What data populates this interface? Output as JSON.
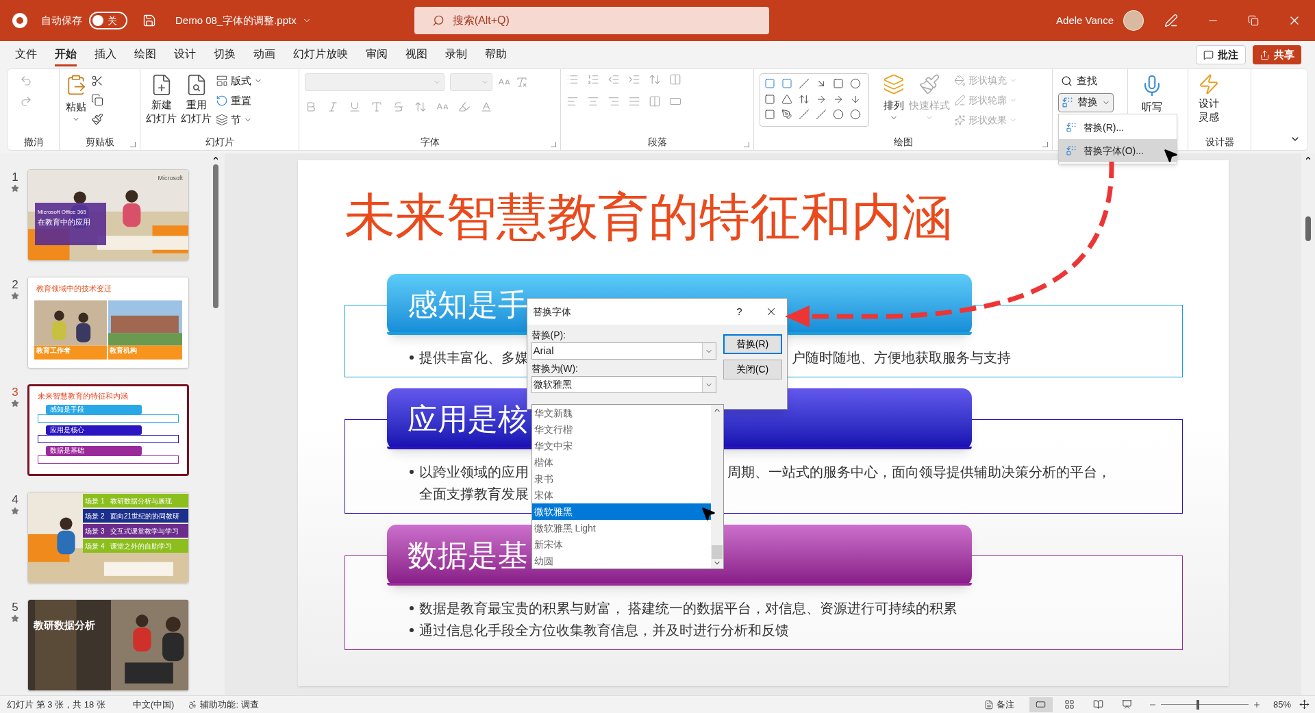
{
  "title_bar": {
    "autosave_label": "自动保存",
    "autosave_toggle": {
      "on": false,
      "label": "关"
    },
    "file_name": "Demo 08_字体的调整.pptx",
    "search_placeholder": "搜索(Alt+Q)",
    "user_name": "Adele Vance"
  },
  "menu_tabs": [
    {
      "label": "文件",
      "selected": false
    },
    {
      "label": "开始",
      "selected": true
    },
    {
      "label": "插入",
      "selected": false
    },
    {
      "label": "绘图",
      "selected": false
    },
    {
      "label": "设计",
      "selected": false
    },
    {
      "label": "切换",
      "selected": false
    },
    {
      "label": "动画",
      "selected": false
    },
    {
      "label": "幻灯片放映",
      "selected": false
    },
    {
      "label": "审阅",
      "selected": false
    },
    {
      "label": "视图",
      "selected": false
    },
    {
      "label": "录制",
      "selected": false
    },
    {
      "label": "帮助",
      "selected": false
    }
  ],
  "comments_button": "批注",
  "share_button": "共享",
  "ribbon": {
    "undo_label": "撤消",
    "clipboard": {
      "paste": "粘贴",
      "label": "剪贴板"
    },
    "slides": {
      "new_slide": [
        "新建",
        "幻灯片"
      ],
      "reuse_slide": [
        "重用",
        "幻灯片"
      ],
      "layout": "版式",
      "reset": "重置",
      "section": "节",
      "label": "幻灯片"
    },
    "font_label": "字体",
    "paragraph_label": "段落",
    "drawing": {
      "arrange": "排列",
      "quick_styles": "快速样式",
      "shape_fill": "形状填充",
      "shape_outline": "形状轮廓",
      "shape_effects": "形状效果",
      "label": "绘图"
    },
    "editing": {
      "find": "查找",
      "replace": "替换"
    },
    "dictate": "听写",
    "designer": {
      "button": [
        "设计",
        "灵感"
      ],
      "label": "设计器"
    }
  },
  "replace_menu": [
    {
      "label": "替换(R)...",
      "selected": false
    },
    {
      "label": "替换字体(O)...",
      "selected": true
    }
  ],
  "thumbnails": [
    {
      "number": "1",
      "selected": false,
      "kind": "cover",
      "brand": "Microsoft",
      "subtitle": "Microsoft Office 365",
      "title": "在教育中的应用"
    },
    {
      "number": "2",
      "selected": false,
      "kind": "two_photos",
      "title": "教育领域中的技术变迁",
      "captions": [
        "教育工作者",
        "教育机构"
      ]
    },
    {
      "number": "3",
      "selected": true,
      "kind": "outline",
      "title": "未来智慧教育的特征和内涵",
      "bars": [
        "感知是手段",
        "应用是核心",
        "数据是基础"
      ]
    },
    {
      "number": "4",
      "selected": false,
      "kind": "scenes",
      "rows": [
        {
          "tag": "场景",
          "index": "1",
          "label": "教研数据分析与展现",
          "color": "#8cbf1e"
        },
        {
          "tag": "场景",
          "index": "2",
          "label": "面向21世纪的协同教研",
          "color": "#1b2f8c"
        },
        {
          "tag": "场景",
          "index": "3",
          "label": "交互式课堂教学与学习",
          "color": "#6b2c8c"
        },
        {
          "tag": "场景",
          "index": "4",
          "label": "课堂之外的自助学习",
          "color": "#8cbf1e"
        }
      ]
    },
    {
      "number": "5",
      "selected": false,
      "kind": "photo_title",
      "title": "教研数据分析"
    }
  ],
  "slide": {
    "title": "未来智慧教育的特征和内涵",
    "sections": [
      {
        "heading": "感知是手",
        "color": "#1a9ee0",
        "lines": [
          {
            "bullet": true,
            "parts": [
              "提供丰富化、多媒",
              "户随时随地、方便地获取服务与支持"
            ]
          }
        ]
      },
      {
        "heading": "应用是核",
        "color": "#2a16c0",
        "lines": [
          {
            "bullet": true,
            "parts": [
              "以跨业领域的应用",
              "周期、一站式的服务中心，面向领导提供辅助决策分析的平台，"
            ]
          },
          {
            "bullet": false,
            "parts": [
              "全面支撑教育发展"
            ]
          }
        ]
      },
      {
        "heading": "数据是基",
        "color": "#9a2a9a",
        "lines": [
          {
            "bullet": true,
            "parts": [
              "数据是教育最宝贵的积累与财富， 搭建统一的数据平台，对信息、资源进行可持续的积累"
            ]
          },
          {
            "bullet": true,
            "parts": [
              "通过信息化手段全方位收集教育信息，并及时进行分析和反馈"
            ]
          }
        ]
      }
    ]
  },
  "dialog": {
    "title": "替换字体",
    "help": "?",
    "replace_label": "替换(P):",
    "replace_value": "Arial",
    "with_label": "替换为(W):",
    "with_value": "微软雅黑",
    "buttons": [
      {
        "label": "替换(R)",
        "default": true
      },
      {
        "label": "关闭(C)",
        "default": false
      }
    ],
    "font_list": [
      {
        "label": "华文新魏",
        "selected": false
      },
      {
        "label": "华文行楷",
        "selected": false
      },
      {
        "label": "华文中宋",
        "selected": false
      },
      {
        "label": "楷体",
        "selected": false
      },
      {
        "label": "隶书",
        "selected": false
      },
      {
        "label": "宋体",
        "selected": false
      },
      {
        "label": "微软雅黑",
        "selected": true
      },
      {
        "label": "微软雅黑 Light",
        "selected": false
      },
      {
        "label": "新宋体",
        "selected": false
      },
      {
        "label": "幼圆",
        "selected": false
      }
    ]
  },
  "status_bar": {
    "slide_info": "幻灯片 第 3 张，共 18 张",
    "language": "中文(中国)",
    "accessibility": "辅助功能: 调查",
    "notes": "备注",
    "views": [
      {
        "kind": "normal",
        "selected": true
      },
      {
        "kind": "sorter",
        "selected": false
      },
      {
        "kind": "reading",
        "selected": false
      },
      {
        "kind": "slideshow",
        "selected": false
      }
    ],
    "zoom": {
      "level": 0.42
    },
    "zoom_percent": "85%"
  }
}
